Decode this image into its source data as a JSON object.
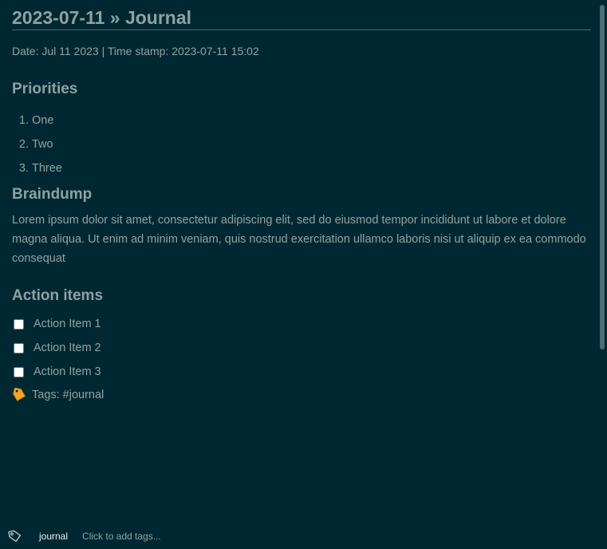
{
  "note": {
    "title": "2023-07-11 » Journal",
    "meta": "Date: Jul 11 2023 | Time stamp: 2023-07-11 15:02",
    "sections": {
      "priorities": {
        "heading": "Priorities",
        "items": [
          "One",
          "Two",
          "Three"
        ]
      },
      "braindump": {
        "heading": "Braindump",
        "text": "Lorem ipsum dolor sit amet, consectetur adipiscing elit, sed do eiusmod tempor incididunt ut labore et dolore magna aliqua. Ut enim ad minim veniam, quis nostrud exercitation ullamco laboris nisi ut aliquip ex ea commodo consequat"
      },
      "action_items": {
        "heading": "Action items",
        "items": [
          {
            "label": "Action Item 1",
            "checked": false
          },
          {
            "label": "Action Item 2",
            "checked": false
          },
          {
            "label": "Action Item 3",
            "checked": false
          }
        ]
      }
    },
    "tags_line": "Tags: #journal"
  },
  "footer": {
    "tag": "journal",
    "add_tags_placeholder": "Click to add tags..."
  },
  "icons": {
    "tag_emoji": "label-tag-icon",
    "footer_tag": "tag-outline-icon"
  },
  "colors": {
    "background": "#002833",
    "text": "#93a1a1",
    "heading": "#8fa1a1",
    "tag_emoji": "#f5a623"
  }
}
